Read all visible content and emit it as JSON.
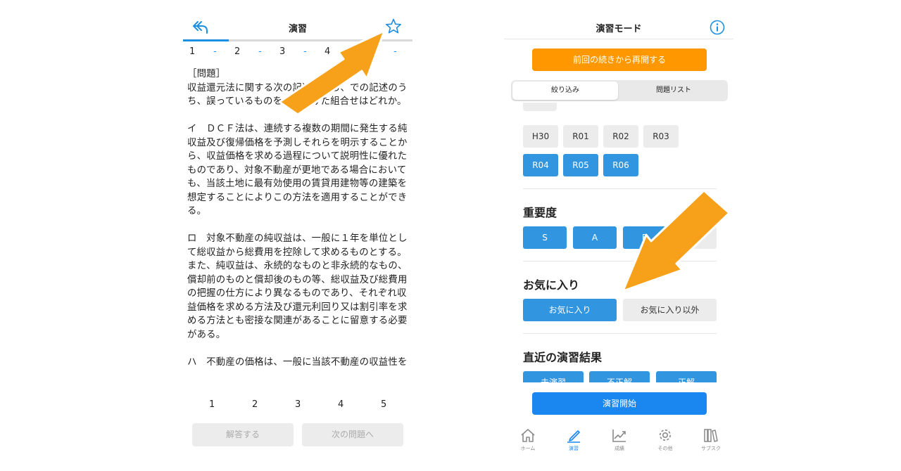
{
  "left_screen": {
    "title": "演習",
    "progress_fraction": 0.2,
    "choice_row": [
      {
        "num": "1",
        "dash": "-"
      },
      {
        "num": "2",
        "dash": "-"
      },
      {
        "num": "3",
        "dash": "-"
      },
      {
        "num": "4",
        "dash": "-"
      },
      {
        "num": "",
        "dash": "-"
      }
    ],
    "question_text": "［問題］\n収益還元法に関する次の記述のうち、での記述のうち、誤っているものを全て掲げた組合せはどれか。\n\nイ　ＤＣＦ法は、連続する複数の期間に発生する純収益及び復帰価格を予測しそれらを明示することから、収益価格を求める過程について説明性に優れたものであり、対象不動産が更地である場合においても、当該土地に最有効使用の賃貸用建物等の建築を想定することによりこの方法を適用することができる。\n\nロ　対象不動産の純収益は、一般に１年を単位として総収益から総費用を控除して求めるものとする。また、純収益は、永続的なものと非永続的なもの、償却前のものと償却後のもの等、総収益及び総費用の把握の仕方により異なるものであり、それぞれ収益価格を求める方法及び還元利回り又は割引率を求める方法とも密接な関連があることに留意する必要がある。\n\nハ　不動産の価格は、一般に当該不動産の収益性を",
    "answer_numbers": [
      "1",
      "2",
      "3",
      "4",
      "5"
    ],
    "answer_button": "解答する",
    "next_button": "次の問題へ"
  },
  "right_screen": {
    "title": "演習モード",
    "resume_button": "前回の続きから再開する",
    "segment_tabs": [
      "絞り込み",
      "問題リスト"
    ],
    "year_chips": [
      {
        "label": "H30",
        "selected": false
      },
      {
        "label": "R01",
        "selected": false
      },
      {
        "label": "R02",
        "selected": false
      },
      {
        "label": "R03",
        "selected": false
      },
      {
        "label": "R04",
        "selected": true
      },
      {
        "label": "R05",
        "selected": true
      },
      {
        "label": "R06",
        "selected": true
      }
    ],
    "importance": {
      "title": "重要度",
      "chips": [
        {
          "label": "S",
          "selected": true
        },
        {
          "label": "A",
          "selected": true
        },
        {
          "label": "B",
          "selected": true
        },
        {
          "label": "",
          "selected": false
        }
      ]
    },
    "favorites": {
      "title": "お気に入り",
      "chips": [
        {
          "label": "お気に入り",
          "selected": true
        },
        {
          "label": "お気に入り以外",
          "selected": false
        }
      ]
    },
    "recent": {
      "title": "直近の演習結果",
      "chips": [
        {
          "label": "未演習",
          "selected": true
        },
        {
          "label": "不正解",
          "selected": true
        },
        {
          "label": "正解",
          "selected": true
        }
      ]
    },
    "start_button": "演習開始",
    "tabbar": [
      {
        "label": "ホーム",
        "icon": "home-icon",
        "active": false
      },
      {
        "label": "演習",
        "icon": "pencil-icon",
        "active": true
      },
      {
        "label": "成績",
        "icon": "chart-icon",
        "active": false
      },
      {
        "label": "その他",
        "icon": "gear-icon",
        "active": false
      },
      {
        "label": "サブスク",
        "icon": "books-icon",
        "active": false
      }
    ]
  },
  "colors": {
    "accent_blue": "#1e8fe0",
    "chip_blue": "#3295e0",
    "orange": "#ff9800",
    "arrow_orange": "#f7a11a"
  }
}
